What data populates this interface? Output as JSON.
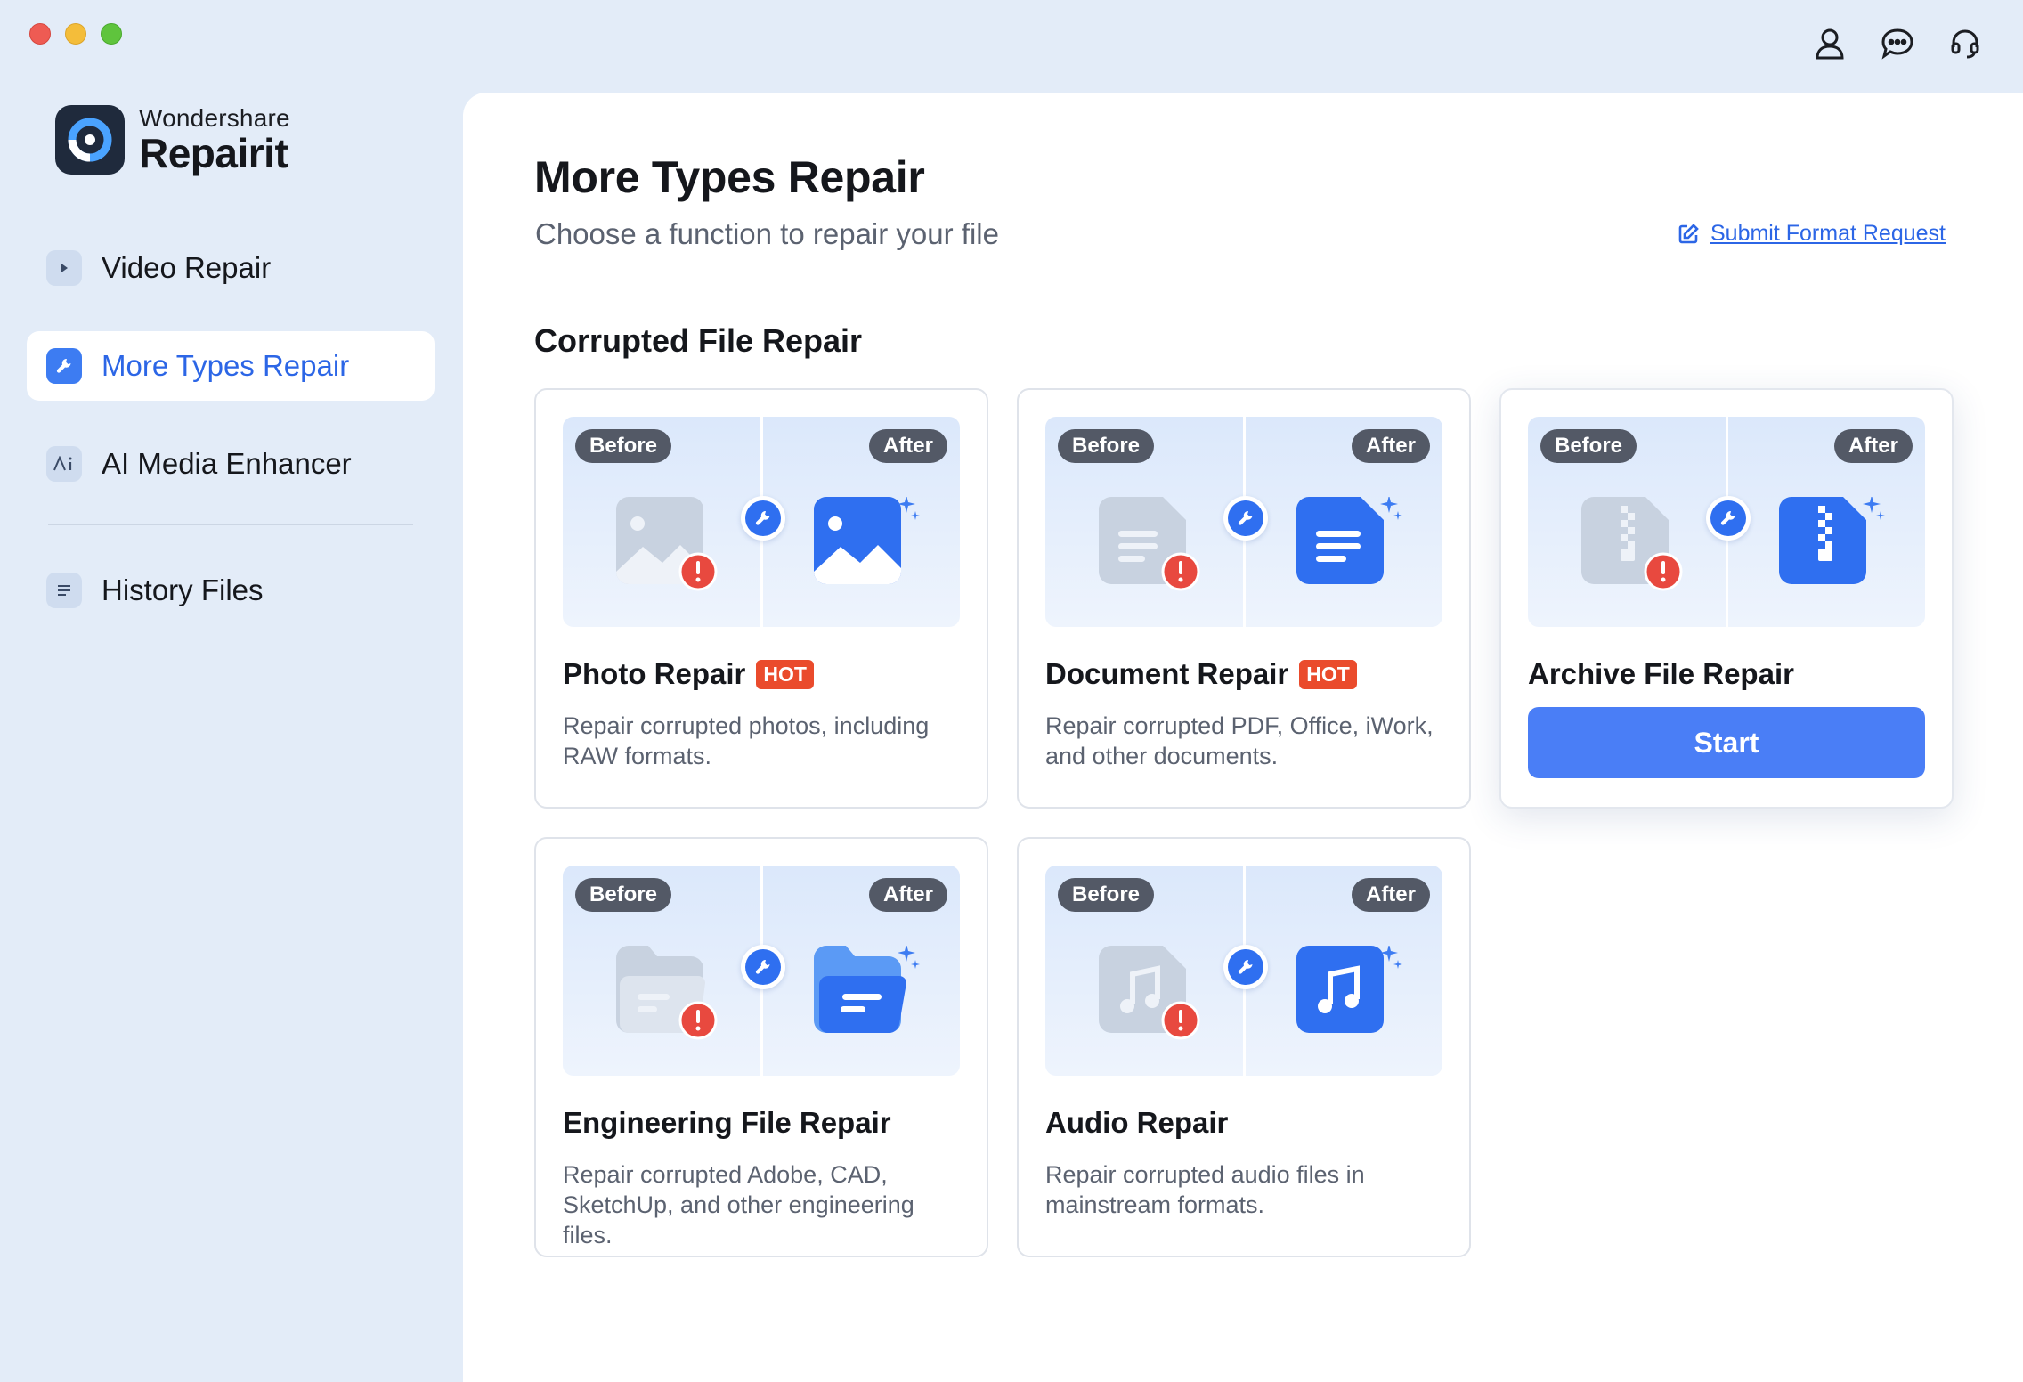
{
  "window": {
    "title": "Wondershare Repairit"
  },
  "brand": {
    "company": "Wondershare",
    "product": "Repairit"
  },
  "sidebar": {
    "items": [
      {
        "label": "Video Repair",
        "icon": "play-icon",
        "active": false
      },
      {
        "label": "More Types Repair",
        "icon": "wrench-icon",
        "active": true
      },
      {
        "label": "AI Media Enhancer",
        "icon": "ai-icon",
        "active": false
      },
      {
        "label": "History Files",
        "icon": "list-icon",
        "active": false
      }
    ]
  },
  "header_icons": [
    "user-icon",
    "chat-icon",
    "headset-icon"
  ],
  "main": {
    "title": "More Types Repair",
    "subtitle": "Choose a function to repair your file",
    "submit_link": "Submit Format Request",
    "section_title": "Corrupted File Repair",
    "badge_before": "Before",
    "badge_after": "After",
    "hot_label": "HOT",
    "start_label": "Start",
    "cards": [
      {
        "title": "Photo Repair",
        "hot": true,
        "description": "Repair corrupted photos, including RAW formats.",
        "icon": "photo-icon"
      },
      {
        "title": "Document Repair",
        "hot": true,
        "description": "Repair corrupted PDF, Office, iWork, and other documents.",
        "icon": "document-icon"
      },
      {
        "title": "Archive File Repair",
        "hot": false,
        "description": "",
        "icon": "archive-icon",
        "hovered": true
      },
      {
        "title": "Engineering File Repair",
        "hot": false,
        "description": "Repair corrupted Adobe, CAD, SketchUp, and other engineering files.",
        "icon": "folder-icon"
      },
      {
        "title": "Audio Repair",
        "hot": false,
        "description": "Repair corrupted audio files in mainstream formats.",
        "icon": "music-icon"
      }
    ]
  },
  "colors": {
    "accent": "#2c66e6",
    "button": "#4a7ef6",
    "hot": "#ea4b2c",
    "sidebar_bg": "#e3ecf8",
    "error": "#e8493f"
  }
}
